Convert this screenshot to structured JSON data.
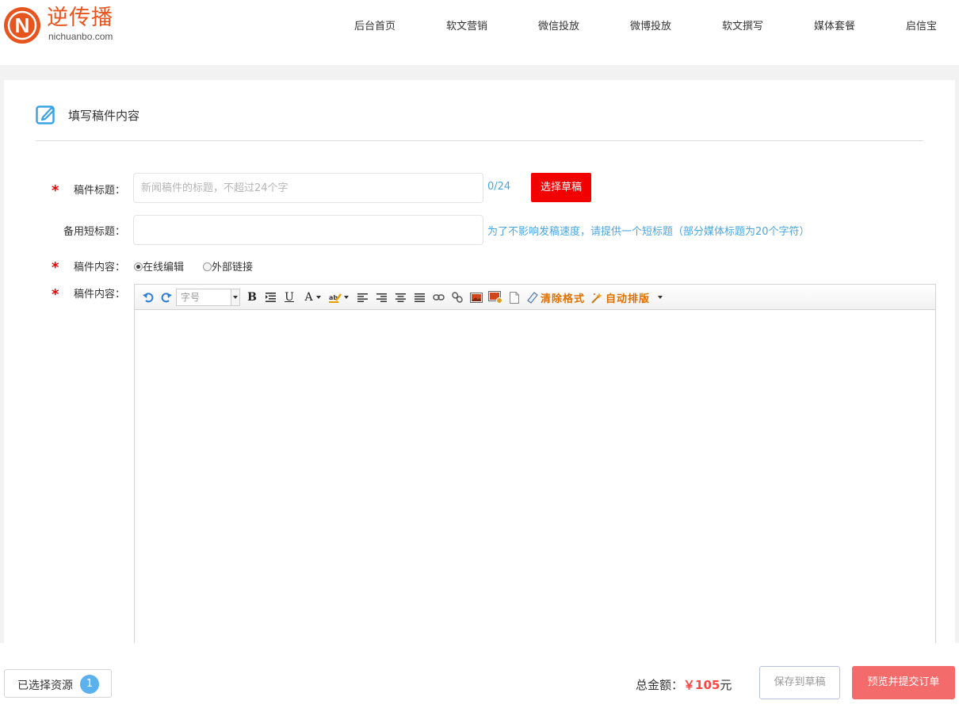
{
  "brand": {
    "name_cn": "逆传播",
    "domain": "nichuanbo.com",
    "badge_letter": "N",
    "color": "#e8541e"
  },
  "nav": [
    {
      "label": "后台首页"
    },
    {
      "label": "软文营销"
    },
    {
      "label": "微信投放"
    },
    {
      "label": "微博投放"
    },
    {
      "label": "软文撰写"
    },
    {
      "label": "媒体套餐"
    },
    {
      "label": "启信宝"
    }
  ],
  "panel": {
    "title": "填写稿件内容"
  },
  "form": {
    "required_mark": "*",
    "title_label": "稿件标题：",
    "title_placeholder": "新闻稿件的标题，不超过24个字",
    "title_value": "",
    "title_counter": "0/24",
    "choose_draft": "选择草稿",
    "short_title_label": "备用短标题：",
    "short_title_value": "",
    "short_title_hint": "为了不影响发稿速度，请提供一个短标题（部分媒体标题为20个字符）",
    "content_mode_label": "稿件内容：",
    "mode_online": "在线编辑",
    "mode_external": "外部链接",
    "mode_selected": "online",
    "content_label": "稿件内容："
  },
  "editor": {
    "font_size_placeholder": "字号",
    "bold": "B",
    "underline": "U",
    "font_color": "A",
    "clear_format": "清除格式",
    "auto_layout": "自动排版",
    "content": ""
  },
  "footer": {
    "selected_label": "已选择资源",
    "selected_count": "1",
    "total_label": "总金额：",
    "total_amount": "￥105",
    "total_unit": "元",
    "save_draft": "保存到草稿",
    "preview_submit": "预览并提交订单"
  },
  "colors": {
    "accent_blue": "#4aa6dd",
    "required_red": "#e60000",
    "draft_btn": "#f20000",
    "submit_btn": "#f46b6b",
    "badge_blue": "#5bb0ee"
  }
}
